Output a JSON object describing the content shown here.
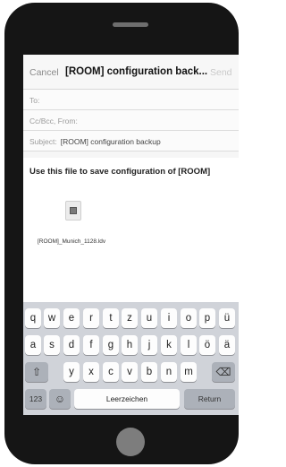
{
  "header": {
    "cancel": "Cancel",
    "title": "[ROOM] configuration back...",
    "send": "Send"
  },
  "fields": {
    "to": "To:",
    "cc": "Cc/Bcc, From:",
    "subject_label": "Subject:",
    "subject_value": "[ROOM] configuration backup"
  },
  "body": {
    "text": "Use this file to save configuration of [ROOM]",
    "attachment": "[ROOM]_Munich_1128.ldv"
  },
  "keyboard": {
    "row1": [
      "q",
      "w",
      "e",
      "r",
      "t",
      "z",
      "u",
      "i",
      "o",
      "p",
      "ü"
    ],
    "row2": [
      "a",
      "s",
      "d",
      "f",
      "g",
      "h",
      "j",
      "k",
      "l",
      "ö",
      "ä"
    ],
    "row3": [
      "y",
      "x",
      "c",
      "v",
      "b",
      "n",
      "m"
    ],
    "shift": "⇧",
    "delete": "⌫",
    "numbers": "123",
    "emoji": "☺",
    "space": "Leerzeichen",
    "return": "Return"
  }
}
